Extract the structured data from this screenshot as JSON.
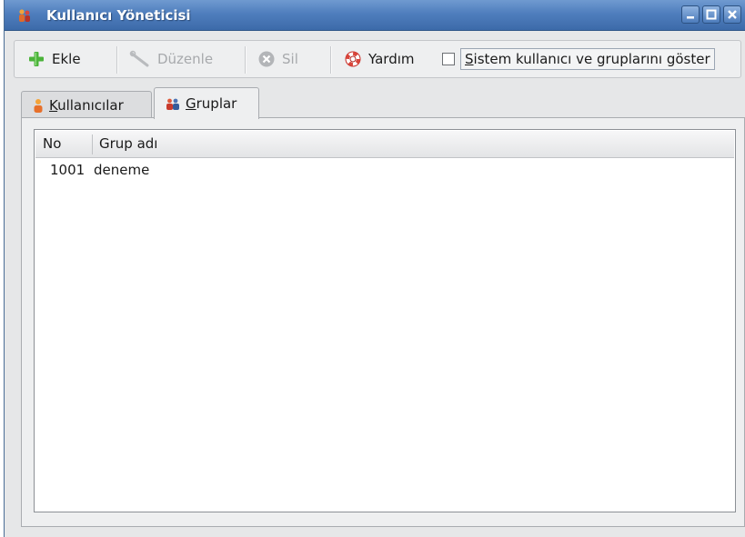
{
  "window": {
    "title": "Kullanıcı Yöneticisi",
    "title_color": "#ffffff",
    "titlebar_color": "#4f7ebd",
    "controls": {
      "minimize": "minimize-icon",
      "maximize": "maximize-icon",
      "close": "close-icon"
    }
  },
  "toolbar": {
    "add_label": "Ekle",
    "add_icon": "plus-icon",
    "edit_label": "Düzenle",
    "edit_icon": "wrench-icon",
    "delete_label": "Sil",
    "delete_icon": "delete-circle-icon",
    "help_label": "Yardım",
    "help_icon": "lifebuoy-icon",
    "show_system_label_accel": "S",
    "show_system_label_rest": "istem kullanıcı ve gruplarını göster",
    "show_system_checked": false
  },
  "tabs": [
    {
      "accel": "K",
      "rest": "ullanıcılar",
      "icon": "user-icon",
      "active": false
    },
    {
      "accel": "G",
      "rest": "ruplar",
      "icon": "group-icon",
      "active": true
    }
  ],
  "groups_table": {
    "columns": [
      "No",
      "Grup adı"
    ],
    "rows": [
      {
        "no": "1001",
        "name": "deneme"
      }
    ]
  }
}
